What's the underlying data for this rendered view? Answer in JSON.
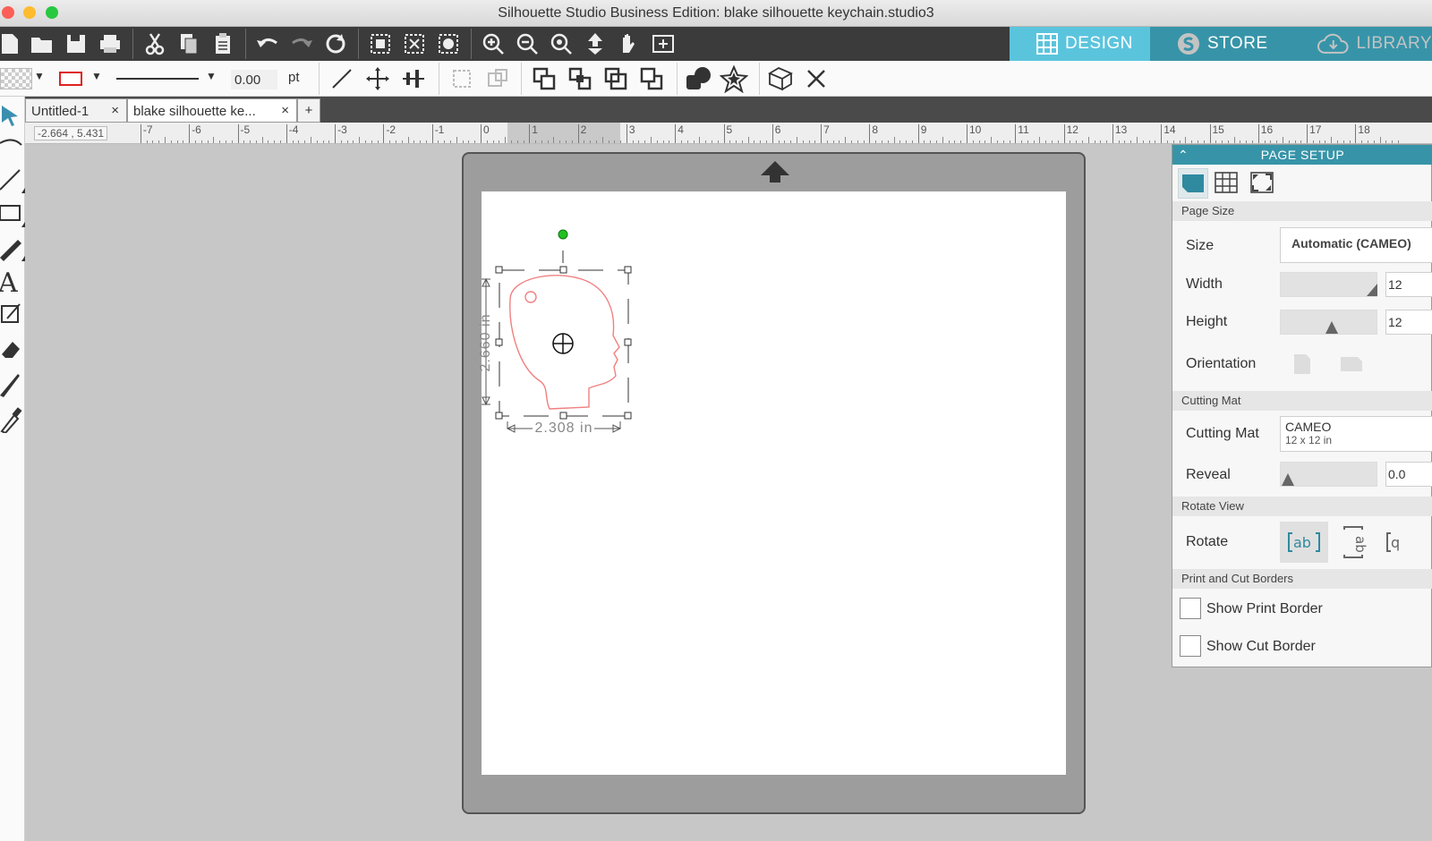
{
  "window": {
    "title": "Silhouette Studio Business Edition: blake silhouette keychain.studio3"
  },
  "nav_tabs": {
    "design": "DESIGN",
    "store": "STORE",
    "library": "LIBRARY"
  },
  "line_options": {
    "line_width": "0.00",
    "unit": "pt"
  },
  "doc_tabs": [
    {
      "label": "Untitled-1",
      "close": "×"
    },
    {
      "label": "blake silhouette ke...",
      "close": "×"
    }
  ],
  "add_tab": "+",
  "ruler": {
    "coords": "-2.664 , 5.431",
    "ticks": [
      "-7",
      "-6",
      "-5",
      "-4",
      "-3",
      "-2",
      "-1",
      "0",
      "1",
      "2",
      "3",
      "4",
      "5",
      "6",
      "7",
      "8",
      "9",
      "10",
      "11",
      "12",
      "13",
      "14",
      "15",
      "16",
      "17",
      "18"
    ]
  },
  "selection": {
    "height_label": "2.660 in",
    "width_label": "2.308 in"
  },
  "page_setup": {
    "title": "PAGE SETUP",
    "page_size_section": "Page Size",
    "size_label": "Size",
    "size_value": "Automatic (CAMEO)",
    "width_label": "Width",
    "width_value": "12",
    "height_label": "Height",
    "height_value": "12",
    "orientation_label": "Orientation",
    "cutting_mat_section": "Cutting Mat",
    "cutting_mat_label": "Cutting Mat",
    "cutting_mat_name": "CAMEO",
    "cutting_mat_size": "12 x 12 in",
    "reveal_label": "Reveal",
    "reveal_value": "0.0",
    "rotate_view_section": "Rotate View",
    "rotate_label": "Rotate",
    "print_cut_section": "Print and Cut Borders",
    "show_print_border": "Show Print Border",
    "show_cut_border": "Show Cut Border"
  },
  "colors": {
    "accent": "#5bc4dd",
    "panel_header": "#3794a8",
    "shape_outline": "#f08080"
  }
}
